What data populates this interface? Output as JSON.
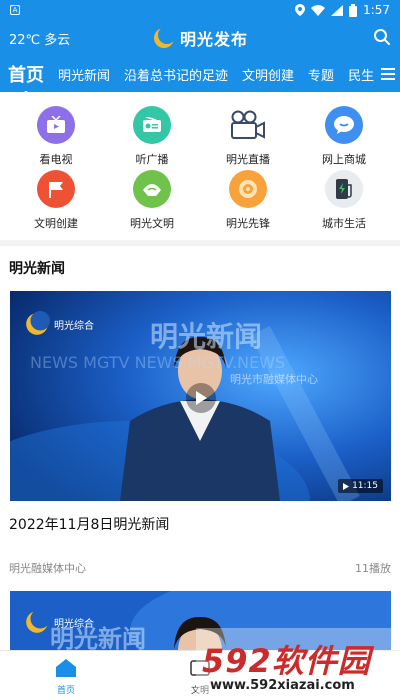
{
  "status_bar": {
    "app_icon_letter": "A",
    "time": "1:57"
  },
  "header": {
    "weather": "22℃ 多云",
    "brand": "明光发布"
  },
  "tabs": [
    {
      "label": "首页",
      "active": true
    },
    {
      "label": "明光新闻"
    },
    {
      "label": "沿着总书记的足迹"
    },
    {
      "label": "文明创建"
    },
    {
      "label": "专题"
    },
    {
      "label": "民生"
    }
  ],
  "services": [
    {
      "label": "看电视",
      "icon": "tv-icon",
      "color": "#8d6fe8"
    },
    {
      "label": "听广播",
      "icon": "radio-icon",
      "color": "#33c7a6"
    },
    {
      "label": "明光直播",
      "icon": "camera-icon",
      "color": "#ffffff"
    },
    {
      "label": "网上商城",
      "icon": "chat-icon",
      "color": "#3f8ff0"
    },
    {
      "label": "文明创建",
      "icon": "flag-icon",
      "color": "#ee5234"
    },
    {
      "label": "明光文明",
      "icon": "hands-icon",
      "color": "#6fc24a"
    },
    {
      "label": "明光先锋",
      "icon": "badge-icon",
      "color": "#f7a23a"
    },
    {
      "label": "城市生活",
      "icon": "charger-icon",
      "color": "#e8ecef"
    }
  ],
  "section": {
    "title": "明光新闻",
    "video": {
      "logo_text": "明光综合",
      "bg_title": "明光新闻",
      "bg_ticker": "NEWS  MGTV  NEWS  MGTV.NEWS",
      "bg_caption": "明光市融媒体中心",
      "duration": "11:15"
    },
    "news_title": "2022年11月8日明光新闻",
    "source": "明光融媒体中心",
    "plays": "11播放",
    "video2": {
      "logo_text": "明光综合",
      "bg_title": "明光新闻"
    }
  },
  "bottom_nav": [
    {
      "label": "首页",
      "active": true,
      "icon": "home-icon"
    },
    {
      "label": "文明",
      "icon": "tv-icon"
    }
  ],
  "watermark": {
    "brand": "592软件园",
    "url": "www.592xiazai.com"
  },
  "colors": {
    "primary": "#1a8fe8",
    "text": "#111111",
    "muted": "#888888"
  }
}
